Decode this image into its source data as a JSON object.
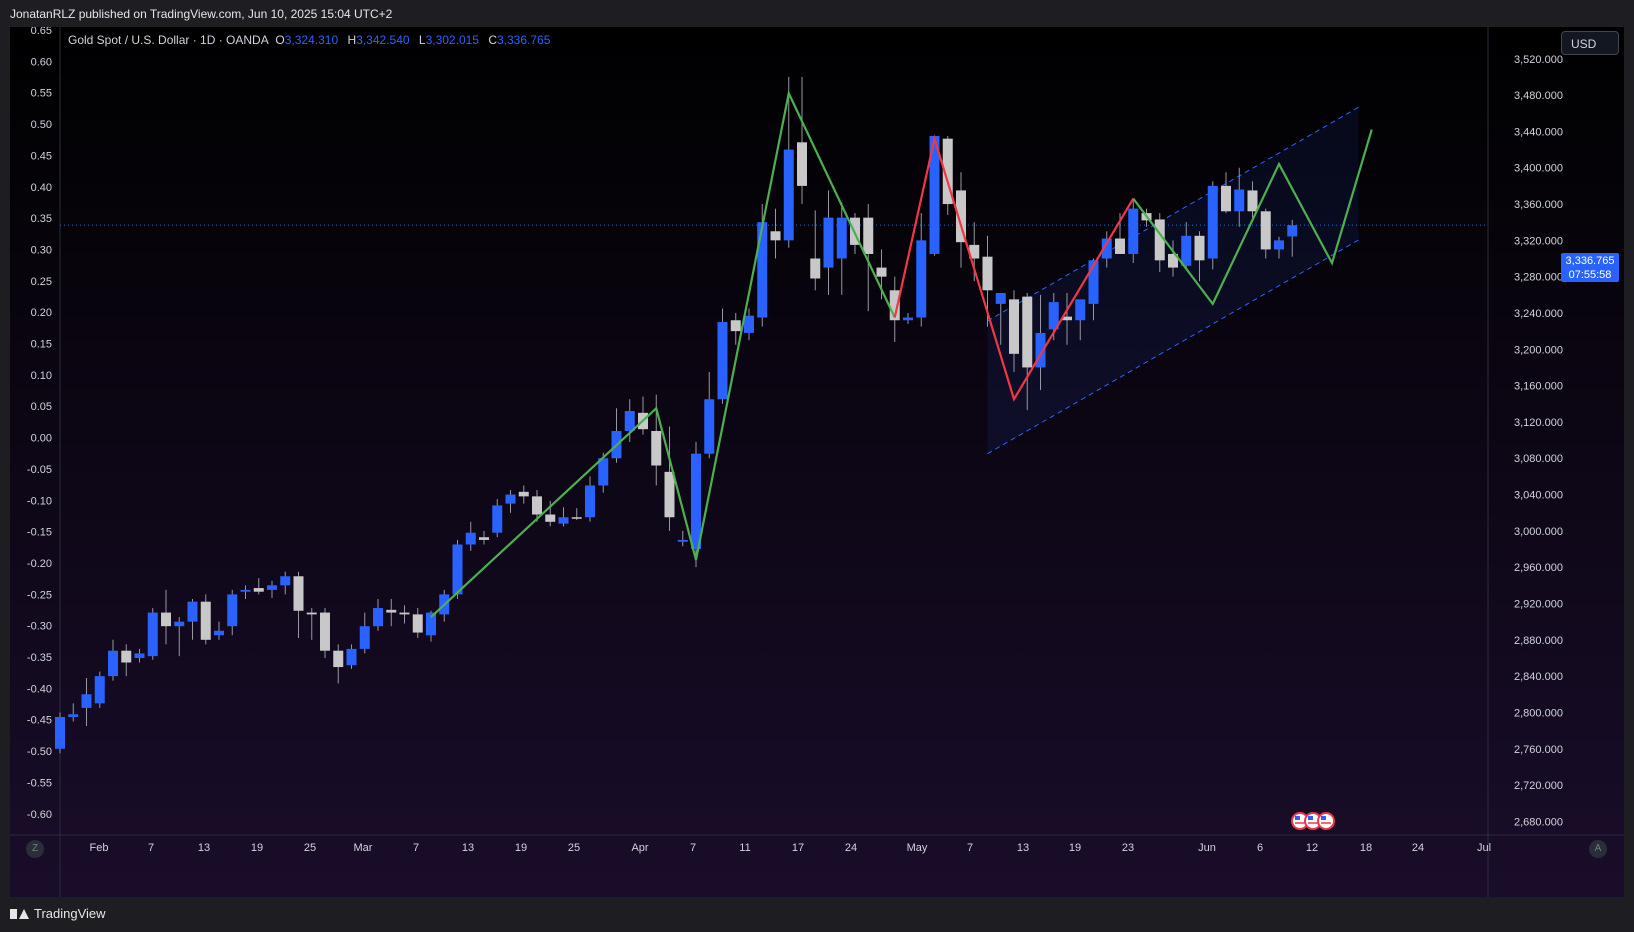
{
  "header": {
    "published": "JonatanRLZ published on TradingView.com, Jun 10, 2025 15:04 UTC+2"
  },
  "legend": {
    "symbol": "Gold Spot / U.S. Dollar · 1D · OANDA",
    "o_label": "O",
    "o_value": "3,324.310",
    "h_label": "H",
    "h_value": "3,342.540",
    "l_label": "L",
    "l_value": "3,302.015",
    "c_label": "C",
    "c_value": "3,336.765"
  },
  "currency_button": "USD",
  "price_tag": {
    "price": "3,336.765",
    "countdown": "07:55:58"
  },
  "footer": {
    "brand": "TradingView"
  },
  "corner_buttons": {
    "left": "Z",
    "right": "A"
  },
  "colors": {
    "background_top": "#000000",
    "background_bottom": "#1a0d2b",
    "bull_candle": "#2962ff",
    "bear_candle": "#c8c8c8",
    "green_line": "#4caf50",
    "red_line": "#f23645",
    "channel_line": "#2962ff",
    "axis_text": "#d1d4dc"
  },
  "chart_data": {
    "type": "candlestick",
    "symbol": "XAUUSD",
    "timeframe": "1D",
    "x_ticks": [
      "Feb",
      "7",
      "13",
      "19",
      "25",
      "Mar",
      "7",
      "13",
      "19",
      "25",
      "Apr",
      "7",
      "11",
      "17",
      "24",
      "May",
      "7",
      "13",
      "19",
      "23",
      "Jun",
      "6",
      "12",
      "18",
      "24",
      "Jul"
    ],
    "right_axis_ticks": [
      "3,520.000",
      "3,480.000",
      "3,440.000",
      "3,400.000",
      "3,360.000",
      "3,320.000",
      "3,280.000",
      "3,240.000",
      "3,200.000",
      "3,160.000",
      "3,120.000",
      "3,080.000",
      "3,040.000",
      "3,000.000",
      "2,960.000",
      "2,920.000",
      "2,880.000",
      "2,840.000",
      "2,800.000",
      "2,760.000",
      "2,720.000",
      "2,680.000"
    ],
    "left_axis_ticks": [
      "0.65",
      "0.60",
      "0.55",
      "0.50",
      "0.45",
      "0.40",
      "0.35",
      "0.30",
      "0.25",
      "0.20",
      "0.15",
      "0.10",
      "0.05",
      "0.00",
      "-0.05",
      "-0.10",
      "-0.15",
      "-0.20",
      "-0.25",
      "-0.30",
      "-0.35",
      "-0.40",
      "-0.45",
      "-0.50",
      "-0.55",
      "-0.60"
    ],
    "ylim_price": [
      2665,
      3555
    ],
    "current_price": 3336.765,
    "candles": [
      {
        "o": 2760,
        "h": 2800,
        "l": 2755,
        "c": 2795
      },
      {
        "o": 2795,
        "h": 2810,
        "l": 2790,
        "c": 2798
      },
      {
        "o": 2805,
        "h": 2838,
        "l": 2785,
        "c": 2820
      },
      {
        "o": 2810,
        "h": 2845,
        "l": 2805,
        "c": 2840
      },
      {
        "o": 2840,
        "h": 2880,
        "l": 2835,
        "c": 2868
      },
      {
        "o": 2868,
        "h": 2875,
        "l": 2840,
        "c": 2855
      },
      {
        "o": 2860,
        "h": 2870,
        "l": 2855,
        "c": 2865
      },
      {
        "o": 2862,
        "h": 2915,
        "l": 2858,
        "c": 2910
      },
      {
        "o": 2910,
        "h": 2935,
        "l": 2875,
        "c": 2895
      },
      {
        "o": 2895,
        "h": 2905,
        "l": 2862,
        "c": 2900
      },
      {
        "o": 2900,
        "h": 2925,
        "l": 2880,
        "c": 2922
      },
      {
        "o": 2922,
        "h": 2930,
        "l": 2875,
        "c": 2880
      },
      {
        "o": 2885,
        "h": 2900,
        "l": 2880,
        "c": 2890
      },
      {
        "o": 2895,
        "h": 2935,
        "l": 2885,
        "c": 2930
      },
      {
        "o": 2933,
        "h": 2940,
        "l": 2925,
        "c": 2935
      },
      {
        "o": 2937,
        "h": 2948,
        "l": 2930,
        "c": 2933
      },
      {
        "o": 2935,
        "h": 2945,
        "l": 2926,
        "c": 2940
      },
      {
        "o": 2940,
        "h": 2955,
        "l": 2930,
        "c": 2950
      },
      {
        "o": 2950,
        "h": 2955,
        "l": 2882,
        "c": 2912
      },
      {
        "o": 2910,
        "h": 2915,
        "l": 2880,
        "c": 2908
      },
      {
        "o": 2910,
        "h": 2915,
        "l": 2860,
        "c": 2868
      },
      {
        "o": 2868,
        "h": 2875,
        "l": 2832,
        "c": 2850
      },
      {
        "o": 2852,
        "h": 2875,
        "l": 2848,
        "c": 2870
      },
      {
        "o": 2870,
        "h": 2910,
        "l": 2865,
        "c": 2895
      },
      {
        "o": 2895,
        "h": 2925,
        "l": 2890,
        "c": 2915
      },
      {
        "o": 2913,
        "h": 2925,
        "l": 2895,
        "c": 2910
      },
      {
        "o": 2910,
        "h": 2918,
        "l": 2898,
        "c": 2908
      },
      {
        "o": 2908,
        "h": 2915,
        "l": 2882,
        "c": 2888
      },
      {
        "o": 2885,
        "h": 2912,
        "l": 2878,
        "c": 2910
      },
      {
        "o": 2908,
        "h": 2935,
        "l": 2900,
        "c": 2930
      },
      {
        "o": 2930,
        "h": 2990,
        "l": 2925,
        "c": 2985
      },
      {
        "o": 2985,
        "h": 3010,
        "l": 2978,
        "c": 2998
      },
      {
        "o": 2993,
        "h": 3000,
        "l": 2985,
        "c": 2990
      },
      {
        "o": 2998,
        "h": 3035,
        "l": 2993,
        "c": 3028
      },
      {
        "o": 3030,
        "h": 3045,
        "l": 3020,
        "c": 3040
      },
      {
        "o": 3043,
        "h": 3050,
        "l": 3030,
        "c": 3038
      },
      {
        "o": 3038,
        "h": 3045,
        "l": 3010,
        "c": 3018
      },
      {
        "o": 3018,
        "h": 3033,
        "l": 3005,
        "c": 3010
      },
      {
        "o": 3008,
        "h": 3026,
        "l": 3005,
        "c": 3015
      },
      {
        "o": 3015,
        "h": 3025,
        "l": 3012,
        "c": 3014
      },
      {
        "o": 3015,
        "h": 3060,
        "l": 3010,
        "c": 3050
      },
      {
        "o": 3050,
        "h": 3086,
        "l": 3042,
        "c": 3080
      },
      {
        "o": 3080,
        "h": 3135,
        "l": 3075,
        "c": 3110
      },
      {
        "o": 3110,
        "h": 3145,
        "l": 3098,
        "c": 3132
      },
      {
        "o": 3130,
        "h": 3148,
        "l": 3106,
        "c": 3112
      },
      {
        "o": 3110,
        "h": 3150,
        "l": 3050,
        "c": 3072
      },
      {
        "o": 3065,
        "h": 3115,
        "l": 3000,
        "c": 3015
      },
      {
        "o": 2988,
        "h": 3000,
        "l": 2983,
        "c": 2990
      },
      {
        "o": 2980,
        "h": 3098,
        "l": 2960,
        "c": 3085
      },
      {
        "o": 3085,
        "h": 3175,
        "l": 3080,
        "c": 3145
      },
      {
        "o": 3145,
        "h": 3245,
        "l": 3140,
        "c": 3230
      },
      {
        "o": 3232,
        "h": 3240,
        "l": 3205,
        "c": 3220
      },
      {
        "o": 3218,
        "h": 3245,
        "l": 3210,
        "c": 3237
      },
      {
        "o": 3235,
        "h": 3360,
        "l": 3225,
        "c": 3340
      },
      {
        "o": 3330,
        "h": 3355,
        "l": 3300,
        "c": 3320
      },
      {
        "o": 3320,
        "h": 3500,
        "l": 3312,
        "c": 3420
      },
      {
        "o": 3428,
        "h": 3500,
        "l": 3360,
        "c": 3380
      },
      {
        "o": 3300,
        "h": 3353,
        "l": 3265,
        "c": 3278
      },
      {
        "o": 3290,
        "h": 3375,
        "l": 3260,
        "c": 3345
      },
      {
        "o": 3300,
        "h": 3362,
        "l": 3260,
        "c": 3345
      },
      {
        "o": 3345,
        "h": 3350,
        "l": 3305,
        "c": 3315
      },
      {
        "o": 3345,
        "h": 3360,
        "l": 3242,
        "c": 3305
      },
      {
        "o": 3290,
        "h": 3310,
        "l": 3255,
        "c": 3280
      },
      {
        "o": 3265,
        "h": 3280,
        "l": 3208,
        "c": 3232
      },
      {
        "o": 3232,
        "h": 3240,
        "l": 3228,
        "c": 3235
      },
      {
        "o": 3235,
        "h": 3350,
        "l": 3225,
        "c": 3320
      },
      {
        "o": 3305,
        "h": 3423,
        "l": 3303,
        "c": 3435
      },
      {
        "o": 3432,
        "h": 3435,
        "l": 3348,
        "c": 3360
      },
      {
        "o": 3375,
        "h": 3395,
        "l": 3290,
        "c": 3318
      },
      {
        "o": 3315,
        "h": 3340,
        "l": 3275,
        "c": 3300
      },
      {
        "o": 3302,
        "h": 3325,
        "l": 3225,
        "c": 3265
      },
      {
        "o": 3250,
        "h": 3260,
        "l": 3205,
        "c": 3262
      },
      {
        "o": 3255,
        "h": 3265,
        "l": 3175,
        "c": 3195
      },
      {
        "o": 3258,
        "h": 3262,
        "l": 3133,
        "c": 3180
      },
      {
        "o": 3180,
        "h": 3260,
        "l": 3155,
        "c": 3218
      },
      {
        "o": 3222,
        "h": 3262,
        "l": 3210,
        "c": 3252
      },
      {
        "o": 3236,
        "h": 3262,
        "l": 3205,
        "c": 3232
      },
      {
        "o": 3232,
        "h": 3252,
        "l": 3210,
        "c": 3255
      },
      {
        "o": 3250,
        "h": 3300,
        "l": 3232,
        "c": 3298
      },
      {
        "o": 3300,
        "h": 3330,
        "l": 3290,
        "c": 3322
      },
      {
        "o": 3322,
        "h": 3350,
        "l": 3305,
        "c": 3305
      },
      {
        "o": 3305,
        "h": 3365,
        "l": 3295,
        "c": 3355
      },
      {
        "o": 3350,
        "h": 3355,
        "l": 3335,
        "c": 3342
      },
      {
        "o": 3343,
        "h": 3350,
        "l": 3285,
        "c": 3298
      },
      {
        "o": 3305,
        "h": 3320,
        "l": 3280,
        "c": 3290
      },
      {
        "o": 3292,
        "h": 3340,
        "l": 3290,
        "c": 3325
      },
      {
        "o": 3325,
        "h": 3330,
        "l": 3275,
        "c": 3298
      },
      {
        "o": 3300,
        "h": 3385,
        "l": 3288,
        "c": 3380
      },
      {
        "o": 3380,
        "h": 3395,
        "l": 3350,
        "c": 3352
      },
      {
        "o": 3352,
        "h": 3400,
        "l": 3335,
        "c": 3376
      },
      {
        "o": 3375,
        "h": 3385,
        "l": 3345,
        "c": 3352
      },
      {
        "o": 3352,
        "h": 3355,
        "l": 3300,
        "c": 3310
      },
      {
        "o": 3310,
        "h": 3324,
        "l": 3300,
        "c": 3320
      },
      {
        "o": 3324.31,
        "h": 3342.54,
        "l": 3302.015,
        "c": 3336.765
      }
    ],
    "green_zigzag_1": [
      {
        "i": 28,
        "p": 2905
      },
      {
        "i": 45,
        "p": 3135
      },
      {
        "i": 48,
        "p": 2968
      },
      {
        "i": 55,
        "p": 3482
      },
      {
        "i": 63,
        "p": 3235
      }
    ],
    "red_zigzag": [
      {
        "i": 63,
        "p": 3235
      },
      {
        "i": 66,
        "p": 3432
      },
      {
        "i": 72,
        "p": 3145
      },
      {
        "i": 81,
        "p": 3366
      }
    ],
    "green_zigzag_2": [
      {
        "i": 81,
        "p": 3366
      },
      {
        "i": 87,
        "p": 3250
      },
      {
        "i": 92,
        "p": 3404
      },
      {
        "i": 96,
        "p": 3295
      },
      {
        "i": 99,
        "p": 3442
      }
    ],
    "channel": {
      "upper": [
        {
          "i": 72,
          "p": 3248
        },
        {
          "i": 99,
          "p": 3475
        }
      ],
      "lower": [
        {
          "i": 70,
          "p": 3085
        },
        {
          "i": 97,
          "p": 3312
        }
      ],
      "x_start": 70,
      "x_end": 98
    }
  }
}
